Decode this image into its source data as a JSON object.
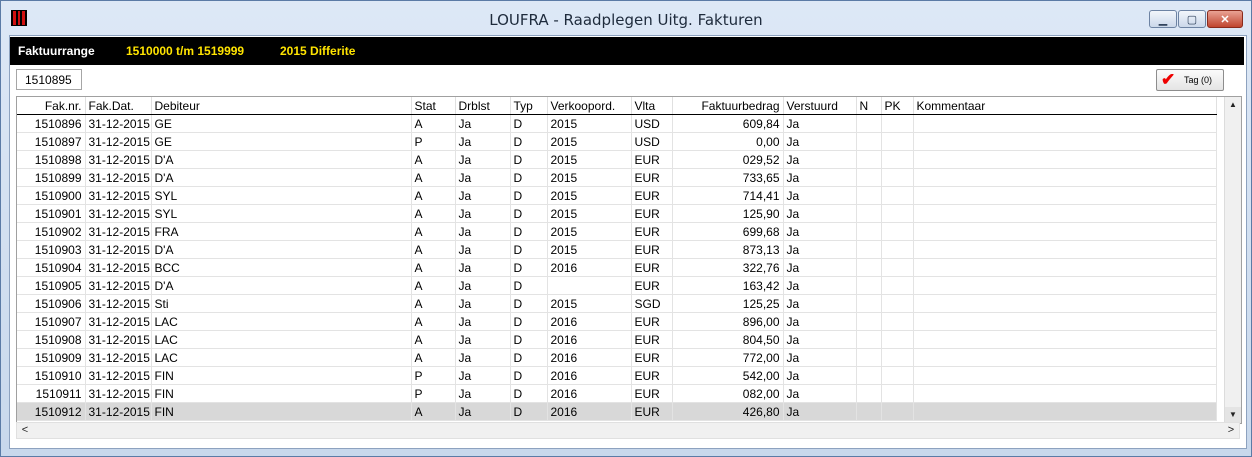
{
  "window": {
    "title": "LOUFRA - Raadplegen Uitg. Fakturen",
    "min_glyph": "▁",
    "max_glyph": "▢",
    "close_glyph": "✕"
  },
  "header": {
    "label": "Faktuurrange",
    "range": "1510000 t/m 1519999",
    "period": "2015 Differite"
  },
  "invoice_field": {
    "value": "1510895"
  },
  "tag_button": {
    "label": "Tag (0)",
    "icon": "checkmark-icon",
    "check_glyph": "✔"
  },
  "columns": [
    "Fak.nr.",
    "Fak.Dat.",
    "Debiteur",
    "Stat",
    "Drblst",
    "Typ",
    "Verkoopord.",
    "Vlta",
    "Faktuurbedrag",
    "Verstuurd",
    "N",
    "PK",
    "Kommentaar"
  ],
  "rows": [
    {
      "nr": "1510896",
      "date": "31-12-2015",
      "deb": "GE",
      "stat": "A",
      "drblst": "Ja",
      "typ": "D",
      "vko": "2015",
      "vlta": "USD",
      "bedrag": "609,84",
      "verst": "Ja"
    },
    {
      "nr": "1510897",
      "date": "31-12-2015",
      "deb": "GE",
      "stat": "P",
      "drblst": "Ja",
      "typ": "D",
      "vko": "2015",
      "vlta": "USD",
      "bedrag": "0,00",
      "verst": "Ja"
    },
    {
      "nr": "1510898",
      "date": "31-12-2015",
      "deb": "D'A",
      "stat": "A",
      "drblst": "Ja",
      "typ": "D",
      "vko": "2015",
      "vlta": "EUR",
      "bedrag": "029,52",
      "verst": "Ja"
    },
    {
      "nr": "1510899",
      "date": "31-12-2015",
      "deb": "D'A",
      "stat": "A",
      "drblst": "Ja",
      "typ": "D",
      "vko": "2015",
      "vlta": "EUR",
      "bedrag": "733,65",
      "verst": "Ja"
    },
    {
      "nr": "1510900",
      "date": "31-12-2015",
      "deb": "SYL",
      "stat": "A",
      "drblst": "Ja",
      "typ": "D",
      "vko": "2015",
      "vlta": "EUR",
      "bedrag": "714,41",
      "verst": "Ja"
    },
    {
      "nr": "1510901",
      "date": "31-12-2015",
      "deb": "SYL",
      "stat": "A",
      "drblst": "Ja",
      "typ": "D",
      "vko": "2015",
      "vlta": "EUR",
      "bedrag": "125,90",
      "verst": "Ja"
    },
    {
      "nr": "1510902",
      "date": "31-12-2015",
      "deb": "FRA",
      "stat": "A",
      "drblst": "Ja",
      "typ": "D",
      "vko": "2015",
      "vlta": "EUR",
      "bedrag": "699,68",
      "verst": "Ja"
    },
    {
      "nr": "1510903",
      "date": "31-12-2015",
      "deb": "D'A",
      "stat": "A",
      "drblst": "Ja",
      "typ": "D",
      "vko": "2015",
      "vlta": "EUR",
      "bedrag": "873,13",
      "verst": "Ja"
    },
    {
      "nr": "1510904",
      "date": "31-12-2015",
      "deb": "BCC",
      "stat": "A",
      "drblst": "Ja",
      "typ": "D",
      "vko": "2016",
      "vlta": "EUR",
      "bedrag": "322,76",
      "verst": "Ja"
    },
    {
      "nr": "1510905",
      "date": "31-12-2015",
      "deb": "D'A",
      "stat": "A",
      "drblst": "Ja",
      "typ": "D",
      "vko": "",
      "vlta": "EUR",
      "bedrag": "163,42",
      "verst": "Ja"
    },
    {
      "nr": "1510906",
      "date": "31-12-2015",
      "deb": "Sti",
      "stat": "A",
      "drblst": "Ja",
      "typ": "D",
      "vko": "2015",
      "vlta": "SGD",
      "bedrag": "125,25",
      "verst": "Ja"
    },
    {
      "nr": "1510907",
      "date": "31-12-2015",
      "deb": "LAC",
      "stat": "A",
      "drblst": "Ja",
      "typ": "D",
      "vko": "2016",
      "vlta": "EUR",
      "bedrag": "896,00",
      "verst": "Ja"
    },
    {
      "nr": "1510908",
      "date": "31-12-2015",
      "deb": "LAC",
      "stat": "A",
      "drblst": "Ja",
      "typ": "D",
      "vko": "2016",
      "vlta": "EUR",
      "bedrag": "804,50",
      "verst": "Ja"
    },
    {
      "nr": "1510909",
      "date": "31-12-2015",
      "deb": "LAC",
      "stat": "A",
      "drblst": "Ja",
      "typ": "D",
      "vko": "2016",
      "vlta": "EUR",
      "bedrag": "772,00",
      "verst": "Ja"
    },
    {
      "nr": "1510910",
      "date": "31-12-2015",
      "deb": "FIN",
      "stat": "P",
      "drblst": "Ja",
      "typ": "D",
      "vko": "2016",
      "vlta": "EUR",
      "bedrag": "542,00",
      "verst": "Ja"
    },
    {
      "nr": "1510911",
      "date": "31-12-2015",
      "deb": "FIN",
      "stat": "P",
      "drblst": "Ja",
      "typ": "D",
      "vko": "2016",
      "vlta": "EUR",
      "bedrag": "082,00",
      "verst": "Ja"
    },
    {
      "nr": "1510912",
      "date": "31-12-2015",
      "deb": "FIN",
      "stat": "A",
      "drblst": "Ja",
      "typ": "D",
      "vko": "2016",
      "vlta": "EUR",
      "bedrag": "426,80",
      "verst": "Ja"
    }
  ],
  "selected_row_index": 16,
  "scrollbar": {
    "up_glyph": "▲",
    "down_glyph": "▼",
    "left_glyph": "<",
    "right_glyph": ">"
  },
  "colors": {
    "header_bg": "#000000",
    "header_accent": "#ffe400",
    "check": "#e00000",
    "selected_row": "#d8d8d8"
  }
}
